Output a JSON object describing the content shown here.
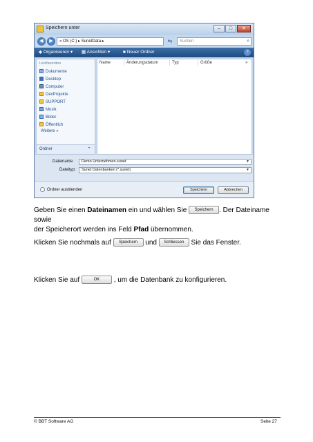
{
  "dialog": {
    "title": "Speichern unter",
    "address": "«  OS (C:)  ▸  SunetData  ▸",
    "search_placeholder": "Suchen",
    "toolbar": {
      "organize": "Organisieren",
      "views": "Ansichten",
      "new_folder": "Neuer Ordner"
    },
    "nav": {
      "heading": "Linkfavoriten",
      "items": [
        "Dokumente",
        "Desktop",
        "Computer",
        "DevProjekte",
        "SUPPORT",
        "Musik",
        "Bilder",
        "Öffentlich"
      ],
      "more": "Weitere  »",
      "folder_toggle": "Ordner"
    },
    "columns": [
      "Name",
      "Änderungsdatum",
      "Typ",
      "Größe"
    ],
    "filename_label": "Dateiname:",
    "filename_value": "Demo Unternehmen.sunet",
    "filetype_label": "Dateityp:",
    "filetype_value": "Sunet Datenbanken (*.sunet)",
    "hide_folders": "Ordner ausblenden",
    "save_button": "Speichern",
    "cancel_button": "Abbrechen"
  },
  "text": {
    "p1_a": "Geben Sie einen ",
    "p1_b": "Dateinamen",
    "p1_c": " ein und wählen Sie ",
    "p1_btn": "Speichern",
    "p1_d": ". Der Dateiname sowie",
    "p1_e": "der Speicherort werden ins Feld ",
    "p1_f": "Pfad",
    "p1_g": " übernommen.",
    "p2_a": "Klicken Sie nochmals auf ",
    "p2_btn1": "Speichern",
    "p2_b": " und ",
    "p2_btn2": "Schliessen",
    "p2_c": " Sie das Fenster.",
    "p3_a": "Klicken Sie auf ",
    "p3_btn": "OK",
    "p3_b": " , um die Datenbank zu konfigurieren."
  },
  "footer": {
    "left": "© BBT Software AG",
    "right": "Seite 27"
  }
}
